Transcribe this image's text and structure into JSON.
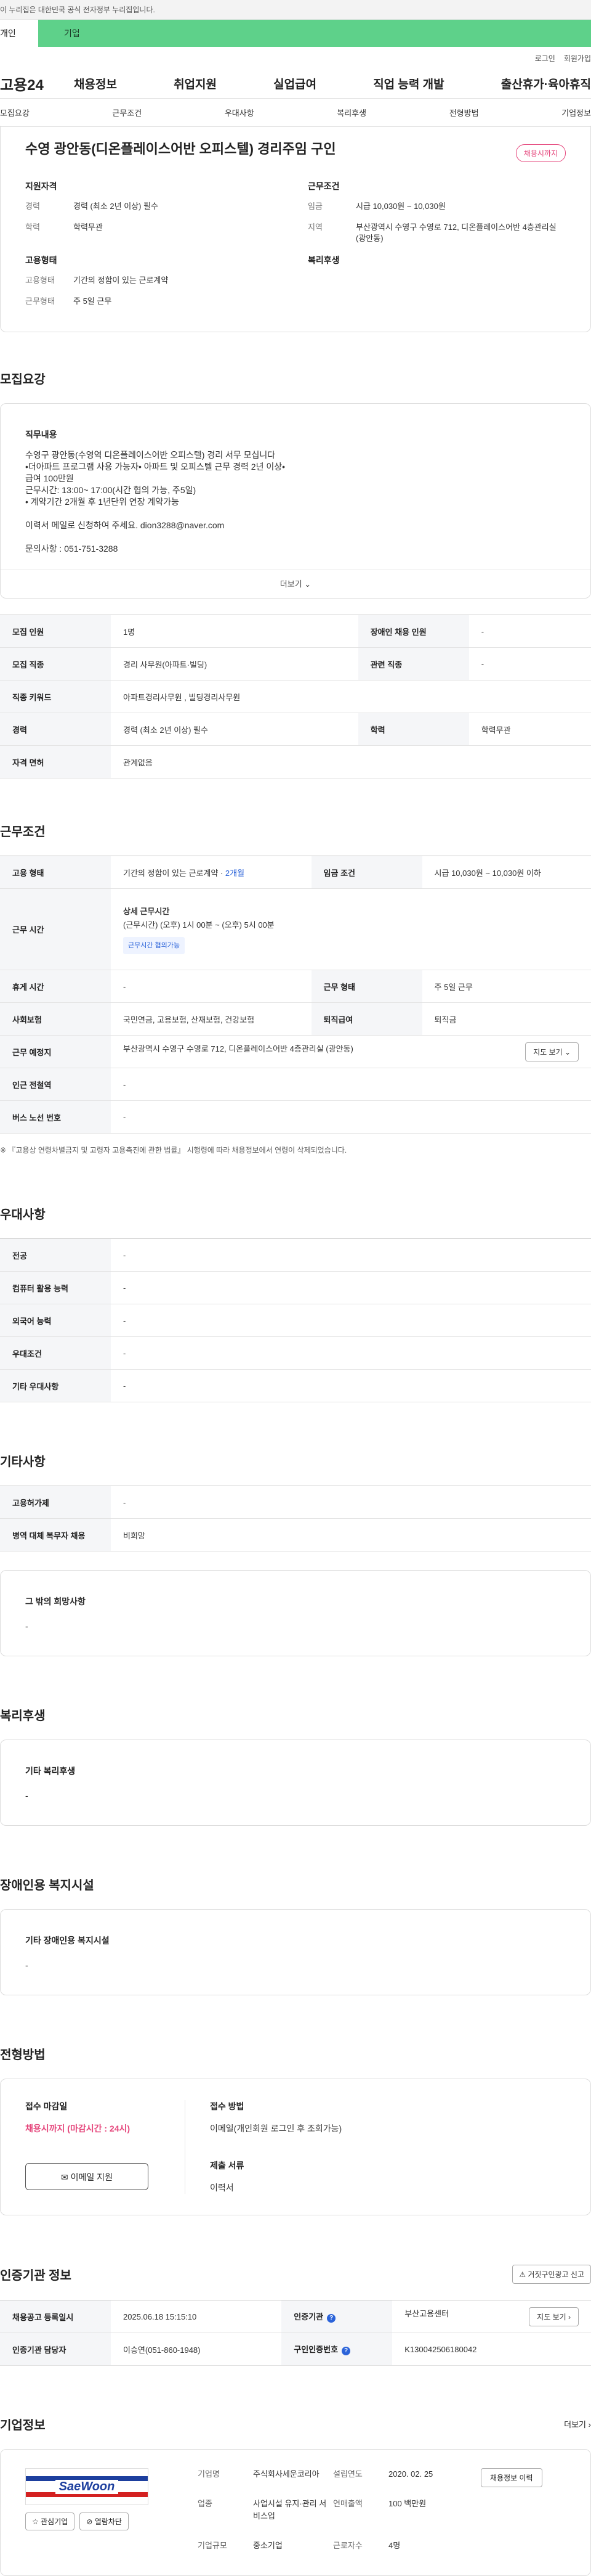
{
  "gov_banner": "이 누리집은 대한민국 공식 전자정부 누리집입니다.",
  "tabs": {
    "person": "개인",
    "business": "기업"
  },
  "util": {
    "login": "로그인",
    "signup": "회원가입"
  },
  "gnb": {
    "logo": "고용24",
    "menu": [
      "채용정보",
      "취업지원",
      "실업급여",
      "직업 능력 개발",
      "출산휴가·육아휴직"
    ]
  },
  "anchor_nav": [
    "모집요강",
    "근무조건",
    "우대사항",
    "복리후생",
    "전형방법",
    "기업정보"
  ],
  "header": {
    "title": "수영 광안동(디온플레이스어반 오피스텔) 경리주임 구인",
    "badge": "채용시까지",
    "qual_title": "지원자격",
    "qual": [
      {
        "k": "경력",
        "v": "경력 (최소 2년 이상) 필수"
      },
      {
        "k": "학력",
        "v": "학력무관"
      }
    ],
    "cond_title": "근무조건",
    "cond": [
      {
        "k": "임금",
        "v": "시급 10,030원 ~ 10,030원"
      },
      {
        "k": "지역",
        "v": "부산광역시 수영구 수영로 712, 디온플레이스어반 4층관리실 (광안동)"
      }
    ],
    "emp_title": "고용형태",
    "emp": [
      {
        "k": "고용형태",
        "v": "기간의 정함이 있는 근로계약"
      },
      {
        "k": "근무형태",
        "v": "주 5일 근무"
      }
    ],
    "welfare_title": "복리후생"
  },
  "recruit": {
    "section_title": "모집요강",
    "desc_label": "직무내용",
    "desc": "수영구 광안동(수영역 디온플레이스어반 오피스텔) 경리 서무 모십니다\n•더아파트 프로그램 사용 가능자• 아파트 및 오피스텔 근무 경력 2년 이상•\n급여 100만원\n근무시간: 13:00~ 17:00(시간 협의 가능, 주5일)\n• 계약기간 2개월 후 1년단위 연장 계약가능\n\n이력서 메일로 신청하여 주세요.    dion3288@naver.com\n\n문의사항 : 051-751-3288",
    "more": "더보기",
    "rows": [
      {
        "k1": "모집 인원",
        "v1": "1명",
        "k2": "장애인 채용 인원",
        "v2": "-"
      },
      {
        "k1": "모집 직종",
        "v1": "경리 사무원(아파트·빌딩)",
        "k2": "관련 직종",
        "v2": "-"
      },
      {
        "k1": "직종 키워드",
        "v1": "아파트경리사무원 , 빌딩경리사무원"
      },
      {
        "k1": "경력",
        "v1": "경력 (최소 2년 이상) 필수",
        "k2": "학력",
        "v2": "학력무관"
      },
      {
        "k1": "자격 면허",
        "v1": "관계없음"
      }
    ]
  },
  "work": {
    "section_title": "근무조건",
    "emp_type_k": "고용 형태",
    "emp_type_v": "기간의 정함이 있는 근로계약 · ",
    "emp_type_extra": "2개월",
    "wage_k": "임금 조건",
    "wage_v": "시급 10,030원 ~ 10,030원 이하",
    "time_k": "근무 시간",
    "time_head": "상세 근무시간",
    "time_v": "(근무시간) (오후) 1시 00분 ~ (오후) 5시 00분",
    "time_tag": "근무시간 협의가능",
    "holiday_k": "휴게 시간",
    "holiday_v": "-",
    "shape_k": "근무 형태",
    "shape_v": "주 5일 근무",
    "ins_k": "사회보험",
    "ins_v": "국민연금, 고용보험, 산재보험, 건강보험",
    "retire_k": "퇴직급여",
    "retire_v": "퇴직금",
    "place_k": "근무 예정지",
    "place_v": "부산광역시 수영구 수영로 712, 디온플레이스어반 4층관리실 (광안동)",
    "map_btn": "지도 보기",
    "station_k": "인근 전철역",
    "station_v": "-",
    "bus_k": "버스 노선 번호",
    "bus_v": "-",
    "note": "※ 『고용상 연령차별금지 및 고령자 고용촉진에 관한 법률』 시행령에 따라 채용정보에서 연령이 삭제되었습니다."
  },
  "prefer": {
    "section_title": "우대사항",
    "rows": [
      {
        "k": "전공",
        "v": "-"
      },
      {
        "k": "컴퓨터 활용 능력",
        "v": "-"
      },
      {
        "k": "외국어 능력",
        "v": "-"
      },
      {
        "k": "우대조건",
        "v": "-"
      },
      {
        "k": "기타 우대사항",
        "v": "-"
      }
    ]
  },
  "etc": {
    "section_title": "기타사항",
    "rows": [
      {
        "k": "고용허가제",
        "v": "-"
      },
      {
        "k": "병역 대체 복무자 채용",
        "v": "비희망"
      }
    ],
    "other_label": "그 밖의 희망사항",
    "other_value": "-"
  },
  "welfare": {
    "section_title": "복리후생",
    "label": "기타 복리후생",
    "value": "-"
  },
  "disabled": {
    "section_title": "장애인용 복지시설",
    "label": "기타 장애인용 복지시설",
    "value": "-"
  },
  "apply": {
    "section_title": "전형방법",
    "deadline_label": "접수 마감일",
    "deadline": "채용시까지 (마감시간 : 24시)",
    "button": "이메일 지원",
    "method_label": "접수 방법",
    "method": "이메일(개인회원 로그인 후 조회가능)",
    "docs_label": "제출 서류",
    "docs": "이력서"
  },
  "cert": {
    "section_title": "인증기관 정보",
    "report_btn": "거짓구인광고 신고",
    "rows": [
      {
        "k1": "채용공고 등록일시",
        "v1": "2025.06.18 15:15:10",
        "k2": "인증기관",
        "v2": "부산고용센터",
        "btn": "지도 보기"
      },
      {
        "k1": "인증기관 담당자",
        "v1": "이승연(051-860-1948)",
        "k2": "구인인증번호",
        "v2": "K130042506180042"
      }
    ]
  },
  "company": {
    "section_title": "기업정보",
    "more": "더보기",
    "logo_text": "SaeWoon",
    "fav_btn": "관심기업",
    "block_btn": "열람차단",
    "detail_btn": "채용정보 이력",
    "info": [
      {
        "k": "기업명",
        "v": "주식회사세운코리아"
      },
      {
        "k": "설립연도",
        "v": "2020. 02. 25"
      },
      {
        "k": "업종",
        "v": "사업시설 유지·관리 서비스업"
      },
      {
        "k": "연매출액",
        "v": "100 백만원"
      },
      {
        "k": "기업규모",
        "v": "중소기업"
      },
      {
        "k": "근로자수",
        "v": "4명"
      }
    ]
  },
  "colors": {
    "accent": "#5ed18a",
    "pink": "#e5457b",
    "blue": "#2b63d9"
  }
}
